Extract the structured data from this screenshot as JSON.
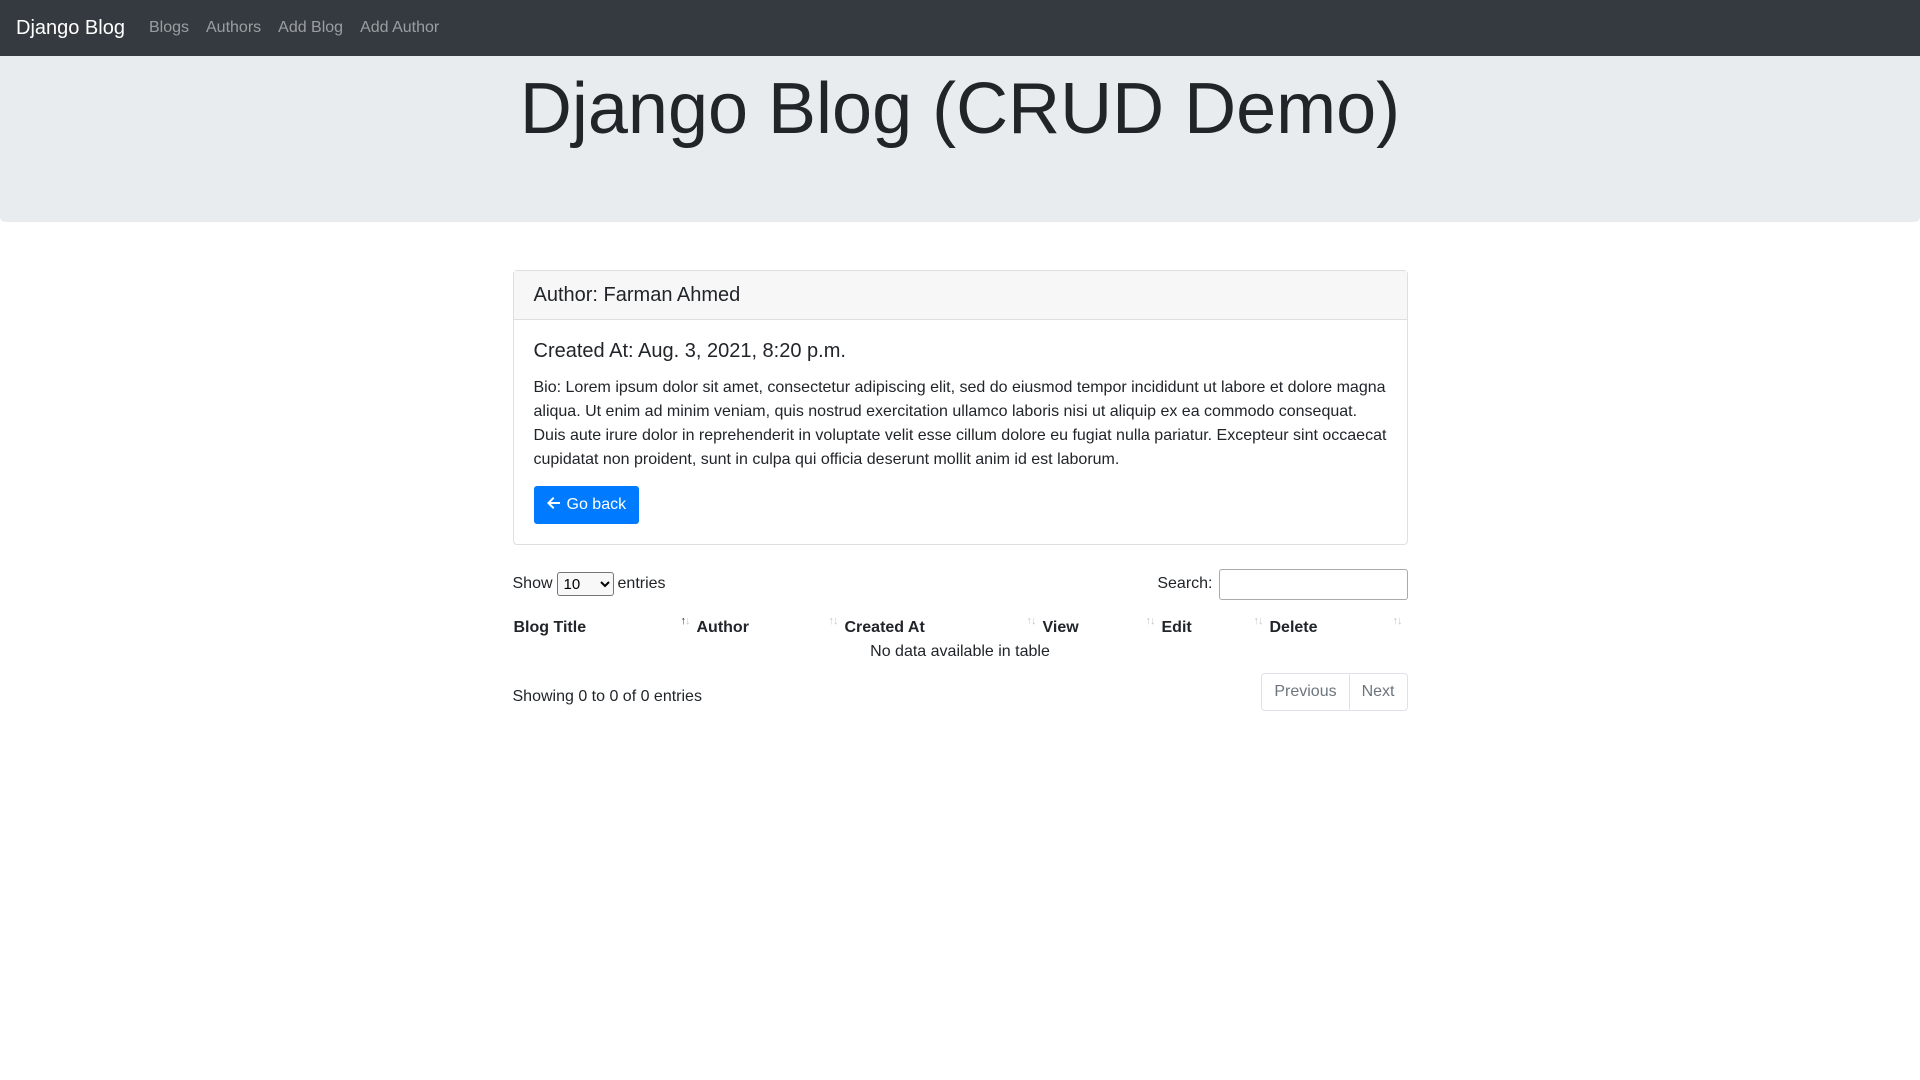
{
  "navbar": {
    "brand": "Django Blog",
    "links": [
      "Blogs",
      "Authors",
      "Add Blog",
      "Add Author"
    ]
  },
  "jumbotron": {
    "title": "Django Blog (CRUD Demo)"
  },
  "author_card": {
    "header": "Author: Farman Ahmed",
    "created_at": "Created At: Aug. 3, 2021, 8:20 p.m.",
    "bio": "Bio: Lorem ipsum dolor sit amet, consectetur adipiscing elit, sed do eiusmod tempor incididunt ut labore et dolore magna aliqua. Ut enim ad minim veniam, quis nostrud exercitation ullamco laboris nisi ut aliquip ex ea commodo consequat. Duis aute irure dolor in reprehenderit in voluptate velit esse cillum dolore eu fugiat nulla pariatur. Excepteur sint occaecat cupidatat non proident, sunt in culpa qui officia deserunt mollit anim id est laborum.",
    "go_back_label": "Go back"
  },
  "datatable": {
    "show_label": "Show",
    "entries_label": "entries",
    "page_length": "10",
    "search_label": "Search:",
    "search_value": "",
    "columns": [
      "Blog Title",
      "Author",
      "Created At",
      "View",
      "Edit",
      "Delete"
    ],
    "empty_message": "No data available in table",
    "info": "Showing 0 to 0 of 0 entries",
    "prev_label": "Previous",
    "next_label": "Next"
  },
  "colors": {
    "navbar": "#343a40",
    "jumbotron": "#e9ecef",
    "primary": "#007bff"
  },
  "icons": {
    "go_back": "arrow-left-icon",
    "sort": "sort-arrows-icon"
  }
}
